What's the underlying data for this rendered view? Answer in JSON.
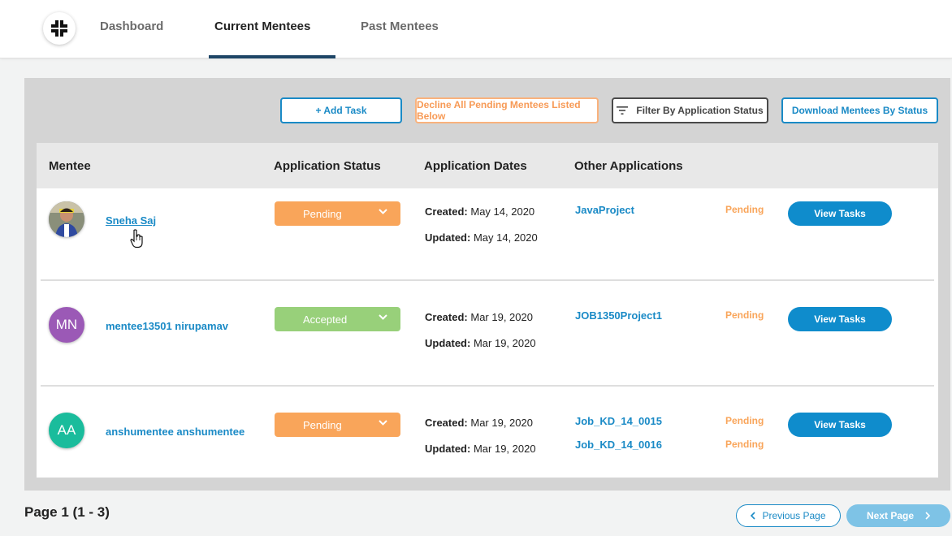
{
  "header": {
    "tabs": [
      {
        "label": "Dashboard"
      },
      {
        "label": "Current Mentees"
      },
      {
        "label": "Past Mentees"
      }
    ]
  },
  "toolbar": {
    "add_task": "+ Add Task",
    "decline_all": "Decline All Pending Mentees Listed Below",
    "filter": "Filter By Application Status",
    "download": "Download Mentees By Status"
  },
  "table": {
    "headers": [
      "Mentee",
      "Application Status",
      "Application Dates",
      "Other Applications"
    ],
    "rows": [
      {
        "name": "Sneha Saj",
        "initials": "",
        "status": "Pending",
        "created_label": "Created:",
        "created": "May 14, 2020",
        "updated_label": "Updated:",
        "updated": "May 14, 2020",
        "applications": [
          {
            "name": "JavaProject",
            "status": "Pending"
          }
        ],
        "view_label": "View Tasks"
      },
      {
        "name": "mentee13501 nirupamav",
        "initials": "MN",
        "status": "Accepted",
        "created_label": "Created:",
        "created": "Mar 19, 2020",
        "updated_label": "Updated:",
        "updated": "Mar 19, 2020",
        "applications": [
          {
            "name": "JOB1350Project1",
            "status": "Pending"
          }
        ],
        "view_label": "View Tasks"
      },
      {
        "name": "anshumentee anshumentee",
        "initials": "AA",
        "status": "Pending",
        "created_label": "Created:",
        "created": "Mar 19, 2020",
        "updated_label": "Updated:",
        "updated": "Mar 19, 2020",
        "applications": [
          {
            "name": "Job_KD_14_0015",
            "status": "Pending"
          },
          {
            "name": "Job_KD_14_0016",
            "status": "Pending"
          }
        ],
        "view_label": "View Tasks"
      }
    ]
  },
  "footer": {
    "page_info": "Page 1 (1 - 3)",
    "previous": "Previous Page",
    "next": "Next Page"
  },
  "colors": {
    "accent_blue": "#1a8ac6",
    "pending": "#f9a55a",
    "accepted": "#98d07a",
    "avatar_mn": "#9b59b6",
    "avatar_aa": "#1abc9c",
    "active_tab_underline": "#1d4566"
  },
  "icons": [
    "logo-icon",
    "filter-icon",
    "chevron-down-icon",
    "chevron-left-icon",
    "chevron-right-icon",
    "hand-cursor-icon"
  ]
}
